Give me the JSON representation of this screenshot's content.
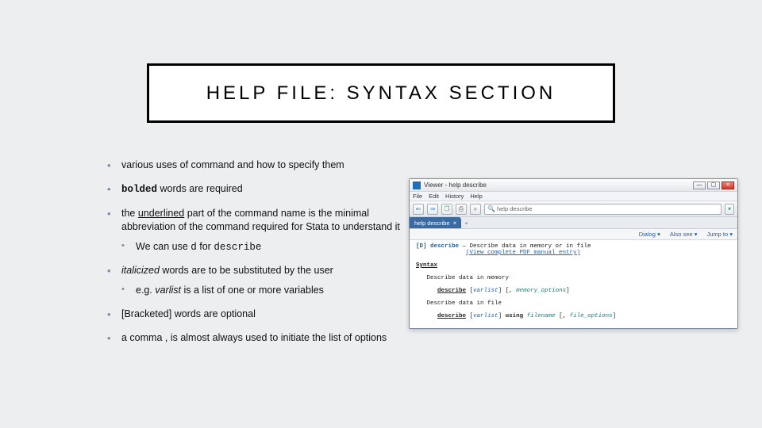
{
  "title": "HELP FILE: SYNTAX SECTION",
  "bullets": {
    "b1": "various uses of command and how to specify them",
    "b2a": "bolded",
    "b2b": " words are required",
    "b3a": "the ",
    "b3b": "underlined",
    "b3c": " part of the command name is the minimal abbreviation of the command required for Stata to understand it",
    "b3_sub_a": "We can use ",
    "b3_sub_b": "d",
    "b3_sub_c": " for ",
    "b3_sub_d": "describe",
    "b4a": "italicized",
    "b4b": " words are to be substituted by the user",
    "b4_sub_a": "e.g. ",
    "b4_sub_b": "varlist",
    "b4_sub_c": " is a list of one or more variables",
    "b5": "[Bracketed] words are optional",
    "b6": "a comma , is almost always used to initiate the list of options"
  },
  "viewer": {
    "win_title": "Viewer - help describe",
    "menu": {
      "file": "File",
      "edit": "Edit",
      "history": "History",
      "help": "Help"
    },
    "toolbar": {
      "back": "⇐",
      "fwd": "⇒",
      "copy": "❐",
      "print": "⎙",
      "find": "⌕",
      "search_text": "help describe",
      "dd": "▾"
    },
    "tab": {
      "label": "help describe",
      "close": "×",
      "plus": "+"
    },
    "head": {
      "dialog": "Dialog ▾",
      "also": "Also see ▾",
      "jump": "Jump to ▾"
    },
    "body": {
      "line1_a": "[D] describe",
      "line1_b": " — Describe data in memory or in file",
      "line2": "(View complete PDF manual entry)",
      "syntax": "Syntax",
      "sec1": "Describe data in memory",
      "d1a": "describe",
      "d1b": " [",
      "d1c": "varlist",
      "d1d": "] [, ",
      "d1e": "memory_options",
      "d1f": "]",
      "sec2": "Describe data in file",
      "d2a": "describe",
      "d2b": " [",
      "d2c": "varlist",
      "d2d": "] ",
      "d2e": "using",
      "d2f": " ",
      "d2g": "filename",
      "d2h": " [, ",
      "d2i": "file_options",
      "d2j": "]"
    }
  }
}
